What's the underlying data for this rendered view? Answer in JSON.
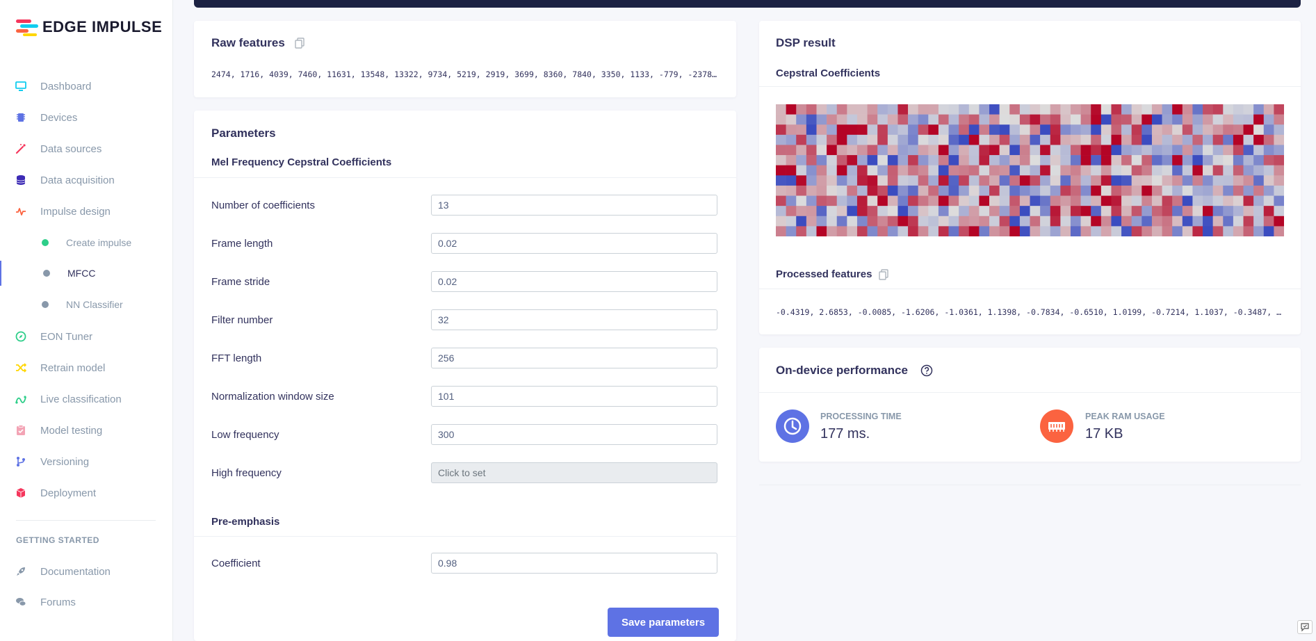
{
  "brand": {
    "name": "EDGE IMPULSE"
  },
  "sidebar": {
    "items": [
      {
        "label": "Dashboard",
        "icon": "monitor-icon",
        "color": "#11cdef"
      },
      {
        "label": "Devices",
        "icon": "chip-icon",
        "color": "#5e72e4"
      },
      {
        "label": "Data sources",
        "icon": "wand-icon",
        "color": "#f5365c"
      },
      {
        "label": "Data acquisition",
        "icon": "database-icon",
        "color": "#3d2bb5"
      },
      {
        "label": "Impulse design",
        "icon": "pulse-icon",
        "color": "#fb6340"
      },
      {
        "label": "Create impulse",
        "sub": true,
        "dot": "#2dce89"
      },
      {
        "label": "MFCC",
        "sub": true,
        "dot": "#8898aa",
        "active": true
      },
      {
        "label": "NN Classifier",
        "sub": true,
        "dot": "#8898aa"
      },
      {
        "label": "EON Tuner",
        "icon": "compass-icon",
        "color": "#2dce89"
      },
      {
        "label": "Retrain model",
        "icon": "shuffle-icon",
        "color": "#ffd600"
      },
      {
        "label": "Live classification",
        "icon": "graph-icon",
        "color": "#2dce89"
      },
      {
        "label": "Model testing",
        "icon": "clipboard-check-icon",
        "color": "#f3a4b5"
      },
      {
        "label": "Versioning",
        "icon": "branch-icon",
        "color": "#5e72e4"
      },
      {
        "label": "Deployment",
        "icon": "box-icon",
        "color": "#f5365c"
      }
    ],
    "getting_started": {
      "heading": "GETTING STARTED",
      "items": [
        {
          "label": "Documentation",
          "icon": "rocket-icon"
        },
        {
          "label": "Forums",
          "icon": "chat-icon"
        }
      ]
    }
  },
  "raw_features": {
    "title": "Raw features",
    "values": "2474, 1716, 4039, 7460, 11631, 13548, 13322, 9734, 5219, 2919, 3699, 8360, 7840, 3350, 1133, -779, -2378, -28…"
  },
  "parameters": {
    "title": "Parameters",
    "mfcc_section": "Mel Frequency Cepstral Coefficients",
    "fields": [
      {
        "label": "Number of coefficients",
        "value": "13"
      },
      {
        "label": "Frame length",
        "value": "0.02"
      },
      {
        "label": "Frame stride",
        "value": "0.02"
      },
      {
        "label": "Filter number",
        "value": "32"
      },
      {
        "label": "FFT length",
        "value": "256"
      },
      {
        "label": "Normalization window size",
        "value": "101"
      },
      {
        "label": "Low frequency",
        "value": "300"
      },
      {
        "label": "High frequency",
        "value": "Click to set",
        "disabled": true
      }
    ],
    "preemphasis_section": "Pre-emphasis",
    "preemphasis_fields": [
      {
        "label": "Coefficient",
        "value": "0.98"
      }
    ],
    "save_label": "Save parameters"
  },
  "dsp_result": {
    "title": "DSP result",
    "cepstral_title": "Cepstral Coefficients",
    "processed_title": "Processed features",
    "processed_values": "-0.4319, 2.6853, -0.0085, -1.6206, -1.0361, 1.1398, -0.7834, -0.6510, 1.0199, -0.7214, 1.1037, -0.3487, 0.191…",
    "heatmap": {
      "rows": 13,
      "cols": 50,
      "low_color": "#3b4cc0",
      "mid_color": "#dddddd",
      "high_color": "#b40426"
    }
  },
  "performance": {
    "title": "On-device performance",
    "processing_label": "PROCESSING TIME",
    "processing_value": "177 ms.",
    "processing_color": "#5e72e4",
    "ram_label": "PEAK RAM USAGE",
    "ram_value": "17 KB",
    "ram_color": "#fb6340"
  }
}
